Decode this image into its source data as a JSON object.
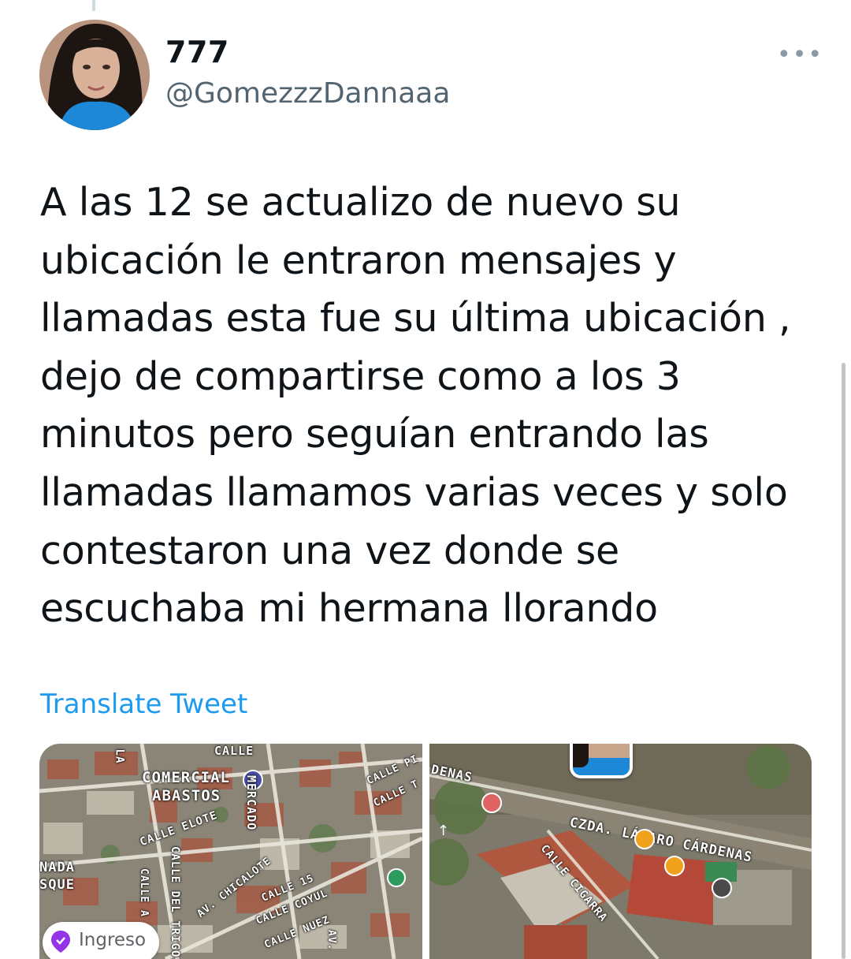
{
  "author": {
    "display_name": "777",
    "handle": "@GomezzzDannaaa"
  },
  "more_label": "•••",
  "tweet": {
    "lines": [
      "A las 12 se actualizo de nuevo su",
      "ubicación le entraron mensajes y",
      "llamadas esta fue su última ubicación ,",
      "dejo de compartirse como a los 3",
      "minutos pero seguían entrando las",
      "llamadas llamamos varias veces y solo",
      "contestaron una vez donde se",
      "escuchaba mi hermana llorando"
    ]
  },
  "translate_label": "Translate Tweet",
  "map_left": {
    "labels": {
      "comercial": "COMERCIAL",
      "abastos": "ABASTOS",
      "calle_elote": "CALLE ELOTE",
      "nada": "NADA",
      "sque": "SQUE",
      "calle_del_trigo": "CALLE DEL TRIGO",
      "av_chicalote": "AV. CHICALOTE",
      "calle_15": "CALLE 15",
      "calle_coyul": "CALLE COYUL",
      "calle_nuez": "CALLE NUEZ",
      "mercado": "MERCADO",
      "calle_top": "CALLE",
      "calle_pi": "CALLE PI",
      "calle_t": "CALLE T",
      "calle_a": "CALLE A",
      "av": "AV.",
      "la": "LA"
    },
    "pill_label": "Ingreso"
  },
  "map_right": {
    "labels": {
      "denas": "DENAS",
      "czda": "CZDA. LÁZARO CÁRDENAS",
      "calle_cigarra": "CALLE CIGARRA"
    }
  },
  "colors": {
    "link": "#1d9bf0",
    "secondary_text": "#536471",
    "pill_icon": "#9334e6"
  }
}
